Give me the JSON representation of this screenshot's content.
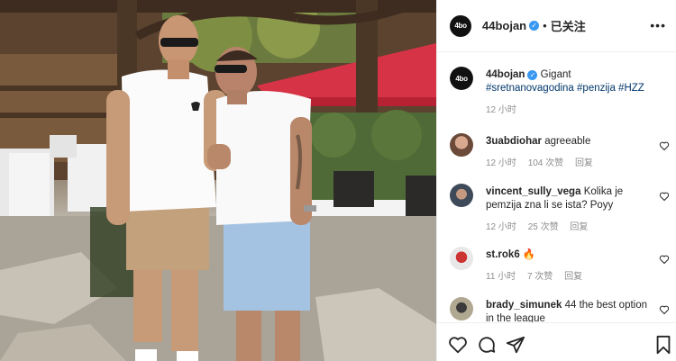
{
  "post_header": {
    "username": "44bojan",
    "separator": "•",
    "follow_status": "已关注",
    "more_icon": "more-dots-icon",
    "logo_text": "4bo"
  },
  "caption": {
    "username": "44bojan",
    "text": "Gigant",
    "hashtags": "#sretnanovagodina #penzija #HZZ",
    "time": "12 小时"
  },
  "comments": [
    {
      "username": "3uabdiohar",
      "text": "agreeable",
      "time": "12 小时",
      "likes": "104 次赞",
      "reply": "回复"
    },
    {
      "username": "vincent_sully_vega",
      "text": "Kolika je pemzija zna li se ista? Poyy",
      "time": "12 小时",
      "likes": "25 次赞",
      "reply": "回复"
    },
    {
      "username": "st.rok6",
      "text": "🔥",
      "time": "11 小时",
      "likes": "7 次赞",
      "reply": "回复"
    },
    {
      "username": "brady_simunek",
      "text": "44 the best option in the league",
      "time": "",
      "likes": "",
      "reply": ""
    }
  ],
  "actions": [
    "heart-icon",
    "comment-icon",
    "share-icon",
    "bookmark-icon"
  ],
  "colors": {
    "verified": "#3897f0",
    "hashtag": "#00376b",
    "meta": "#8e8e8e",
    "text": "#262626"
  }
}
